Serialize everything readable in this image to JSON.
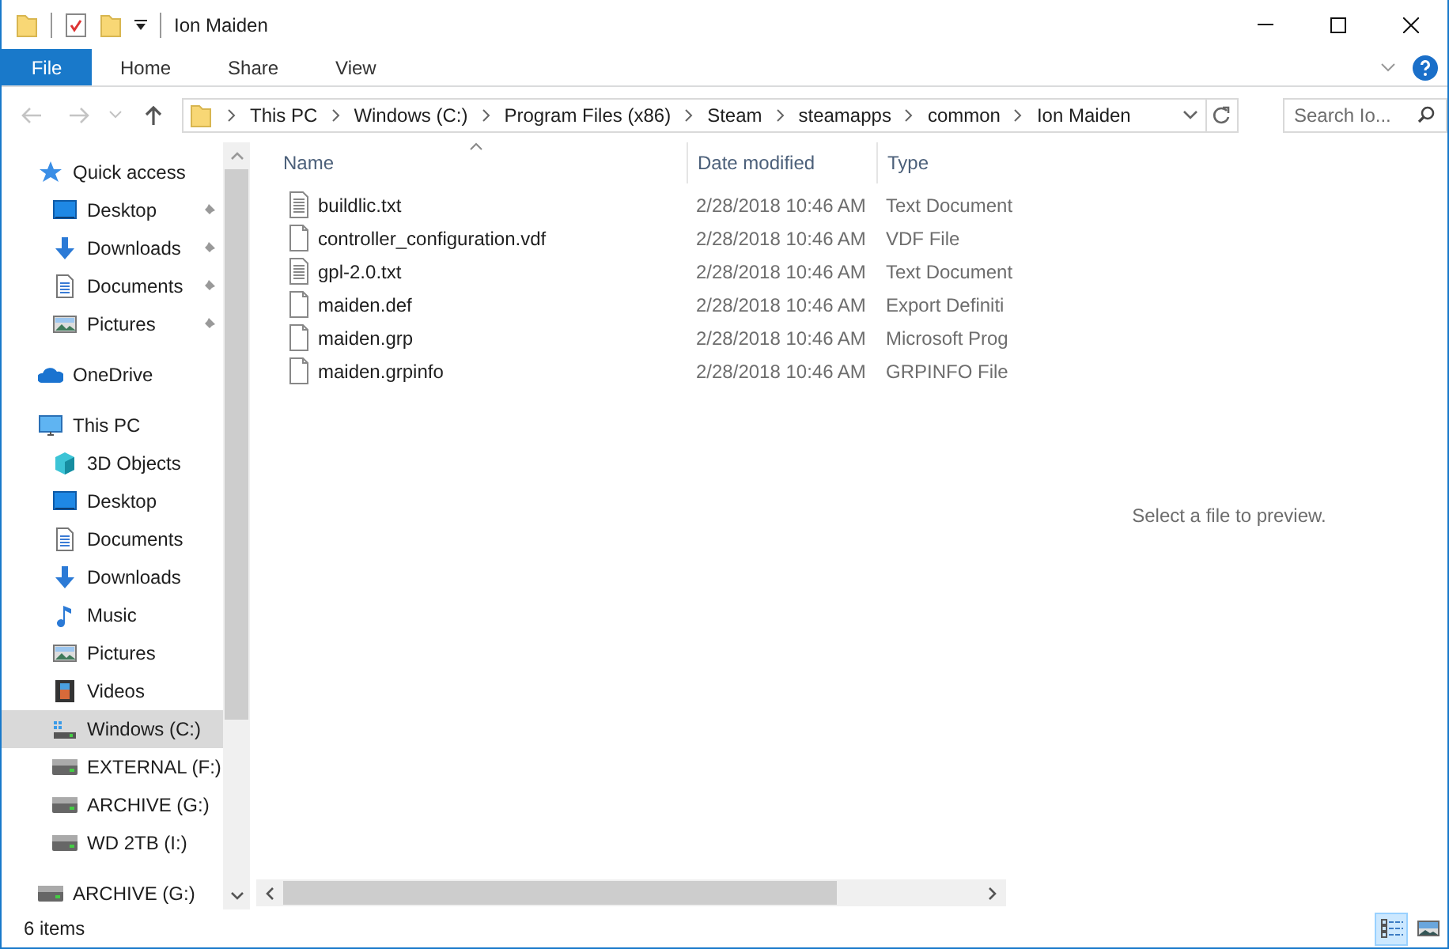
{
  "window": {
    "title": "Ion Maiden"
  },
  "ribbon": {
    "tabs": [
      {
        "label": "File",
        "kind": "file"
      },
      {
        "label": "Home",
        "kind": "tab"
      },
      {
        "label": "Share",
        "kind": "tab"
      },
      {
        "label": "View",
        "kind": "tab"
      }
    ]
  },
  "address_bar": {
    "path": [
      "This PC",
      "Windows (C:)",
      "Program Files (x86)",
      "Steam",
      "steamapps",
      "common",
      "Ion Maiden"
    ]
  },
  "search": {
    "placeholder": "Search Io..."
  },
  "navigation": [
    {
      "label": "Quick access",
      "kind": "star",
      "selected": false,
      "children": [
        {
          "label": "Desktop",
          "kind": "desktop",
          "pinned": true,
          "selected": false
        },
        {
          "label": "Downloads",
          "kind": "download",
          "pinned": true,
          "selected": false
        },
        {
          "label": "Documents",
          "kind": "document",
          "pinned": true,
          "selected": false
        },
        {
          "label": "Pictures",
          "kind": "picture",
          "pinned": true,
          "selected": false
        }
      ]
    },
    {
      "label": "OneDrive",
      "kind": "cloud",
      "selected": false
    },
    {
      "label": "This PC",
      "kind": "pc",
      "selected": false,
      "children": [
        {
          "label": "3D Objects",
          "kind": "cube",
          "pinned": false,
          "selected": false
        },
        {
          "label": "Desktop",
          "kind": "desktop",
          "pinned": false,
          "selected": false
        },
        {
          "label": "Documents",
          "kind": "document",
          "pinned": false,
          "selected": false
        },
        {
          "label": "Downloads",
          "kind": "download",
          "pinned": false,
          "selected": false
        },
        {
          "label": "Music",
          "kind": "music",
          "pinned": false,
          "selected": false
        },
        {
          "label": "Pictures",
          "kind": "picture",
          "pinned": false,
          "selected": false
        },
        {
          "label": "Videos",
          "kind": "video",
          "pinned": false,
          "selected": false
        },
        {
          "label": "Windows (C:)",
          "kind": "system-drive",
          "pinned": false,
          "selected": true
        },
        {
          "label": "EXTERNAL (F:)",
          "kind": "drive",
          "pinned": false,
          "selected": false
        },
        {
          "label": "ARCHIVE (G:)",
          "kind": "drive",
          "pinned": false,
          "selected": false
        },
        {
          "label": "WD 2TB (I:)",
          "kind": "drive",
          "pinned": false,
          "selected": false
        }
      ]
    },
    {
      "label": "ARCHIVE (G:)",
      "kind": "drive",
      "selected": false
    }
  ],
  "file_list": {
    "columns": [
      {
        "label": "Name",
        "sorted": true
      },
      {
        "label": "Date modified",
        "sorted": false
      },
      {
        "label": "Type",
        "sorted": false
      }
    ],
    "rows": [
      {
        "name": "buildlic.txt",
        "date_modified": "2/28/2018 10:46 AM",
        "type": "Text Document",
        "kind": "text"
      },
      {
        "name": "controller_configuration.vdf",
        "date_modified": "2/28/2018 10:46 AM",
        "type": "VDF File",
        "kind": "blank"
      },
      {
        "name": "gpl-2.0.txt",
        "date_modified": "2/28/2018 10:46 AM",
        "type": "Text Document",
        "kind": "text"
      },
      {
        "name": "maiden.def",
        "date_modified": "2/28/2018 10:46 AM",
        "type": "Export Definiti",
        "kind": "blank"
      },
      {
        "name": "maiden.grp",
        "date_modified": "2/28/2018 10:46 AM",
        "type": "Microsoft Prog",
        "kind": "blank"
      },
      {
        "name": "maiden.grpinfo",
        "date_modified": "2/28/2018 10:46 AM",
        "type": "GRPINFO File",
        "kind": "blank"
      }
    ]
  },
  "preview_pane": {
    "message": "Select a file to preview."
  },
  "status_bar": {
    "item_count": "6 items",
    "views": [
      {
        "kind": "details",
        "selected": true
      },
      {
        "kind": "large-icons",
        "selected": false
      }
    ]
  }
}
